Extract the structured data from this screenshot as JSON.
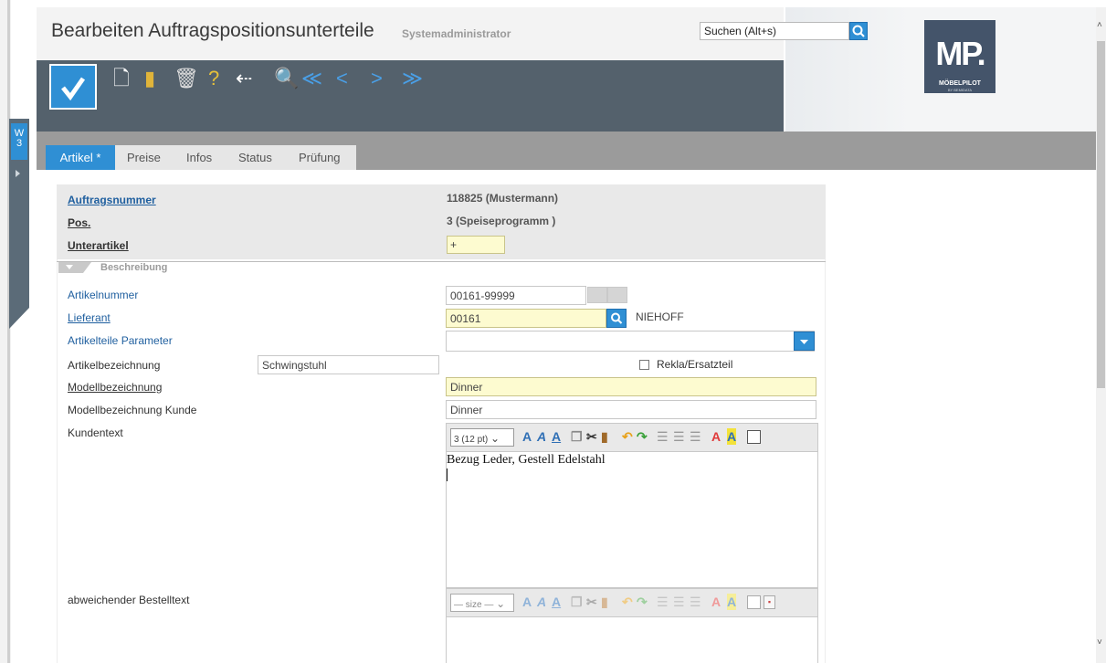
{
  "window": {
    "title": "Bearbeiten Auftragspositionsunterteile",
    "user": "Systemadministrator",
    "search_placeholder": "Suchen (Alt+s)",
    "logo_text": "MP.",
    "logo_sub": "MÖBELPILOT",
    "logo_sub2": "BY BEMIDATA"
  },
  "side_tab": {
    "label": "W\n3"
  },
  "toolbar": {
    "save_icon": "checkmark-icon",
    "icons": [
      "new-document-icon",
      "open-folder-icon",
      "trash-icon",
      "help-icon",
      "back-icon",
      "search-icon",
      "first-record-icon",
      "previous-record-icon",
      "next-record-icon",
      "last-record-icon"
    ],
    "glyphs": [
      "🗋",
      "▮",
      "🗑",
      "?",
      "⇠",
      "🔍",
      "≪",
      "<",
      ">",
      "≫"
    ]
  },
  "tabs": [
    {
      "label": "Artikel *",
      "active": true
    },
    {
      "label": "Preise",
      "active": false
    },
    {
      "label": "Infos",
      "active": false
    },
    {
      "label": "Status",
      "active": false
    },
    {
      "label": "Prüfung",
      "active": false
    }
  ],
  "header_fields": {
    "auftragsnummer_label": "Auftragsnummer",
    "auftragsnummer_value": "118825 (Mustermann)",
    "pos_label": "Pos.",
    "pos_value": "3 (Speiseprogramm )",
    "unterartikel_label": "Unterartikel",
    "unterartikel_value": "+"
  },
  "section": {
    "label": "Beschreibung"
  },
  "fields": {
    "artikelnummer_label": "Artikelnummer",
    "artikelnummer_value": "00161-99999",
    "lieferant_label": "Lieferant",
    "lieferant_value": "00161",
    "lieferant_name": "NIEHOFF",
    "artikelteile_label": "Artikelteile Parameter",
    "artikelteile_value": "",
    "artikelbezeichnung_label": "Artikelbezeichnung",
    "artikelbezeichnung_value": "Schwingstuhl",
    "rekla_label": "Rekla/Ersatzteil",
    "modellbezeichnung_label": "Modellbezeichnung",
    "modellbezeichnung_value": "Dinner",
    "modellbezeichnung_kunde_label": "Modellbezeichnung Kunde",
    "modellbezeichnung_kunde_value": "Dinner",
    "kundentext_label": "Kundentext",
    "kundentext_size": "3 (12 pt)",
    "kundentext_value": "Bezug Leder, Gestell Edelstahl",
    "bestelltext_label": "abweichender Bestelltext",
    "bestelltext_size": "— size —"
  },
  "colors": {
    "accent": "#2f8fd4",
    "toolbar_dark": "#54616c",
    "mandatory_yellow": "#fdfbd0"
  }
}
